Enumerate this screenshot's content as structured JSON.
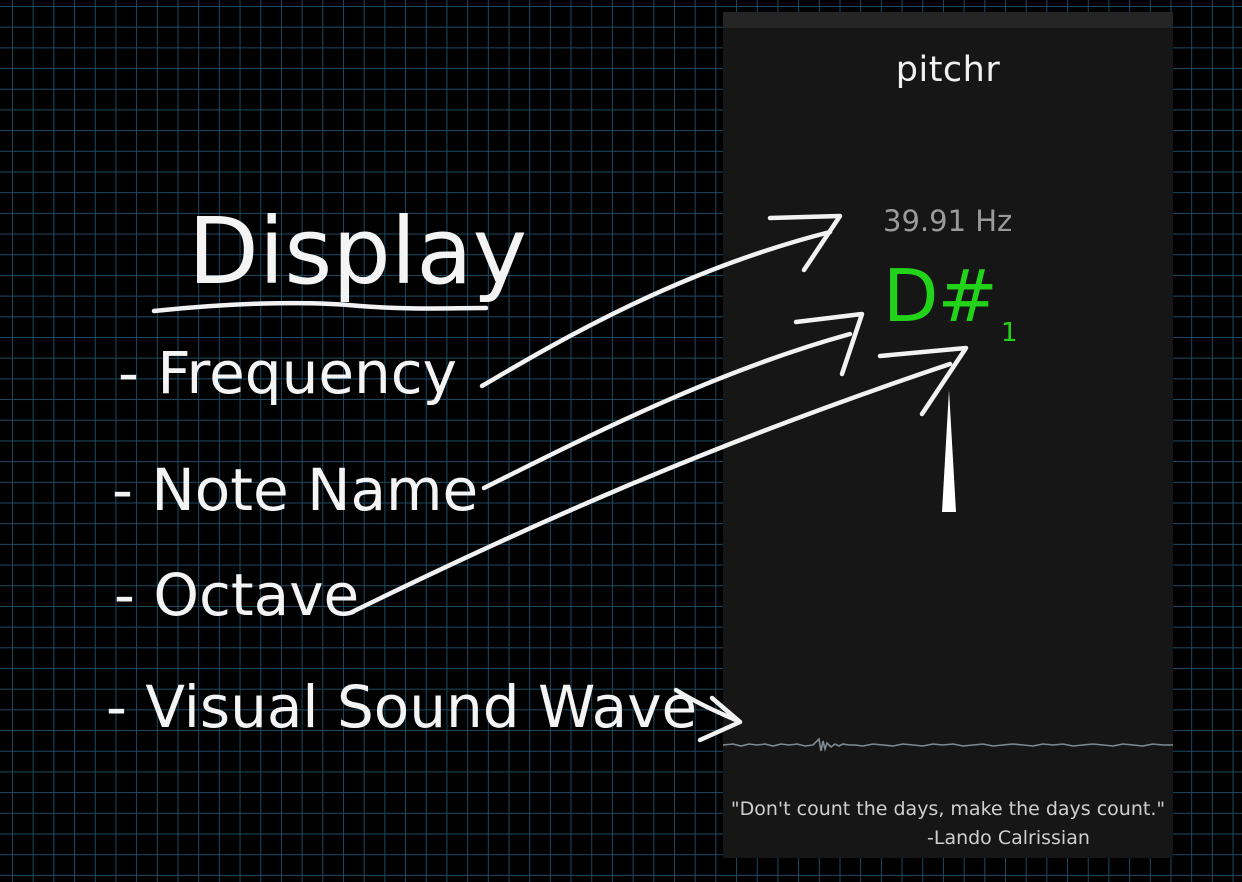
{
  "sketch": {
    "heading": "Display",
    "items": [
      "- Frequency",
      "- Note Name",
      "- Octave",
      "- Visual Sound Wave"
    ]
  },
  "app": {
    "title": "pitchr",
    "frequency": "39.91 Hz",
    "note": "D#",
    "octave": "1",
    "quote": "\"Don't count the days, make the days count.\"",
    "quote_author": "-Lando Calrissian"
  },
  "colors": {
    "background": "#000000",
    "grid": "#1d4a63",
    "app_background": "#161616",
    "note_green": "#22d31a",
    "ink": "#f2f2f2"
  }
}
